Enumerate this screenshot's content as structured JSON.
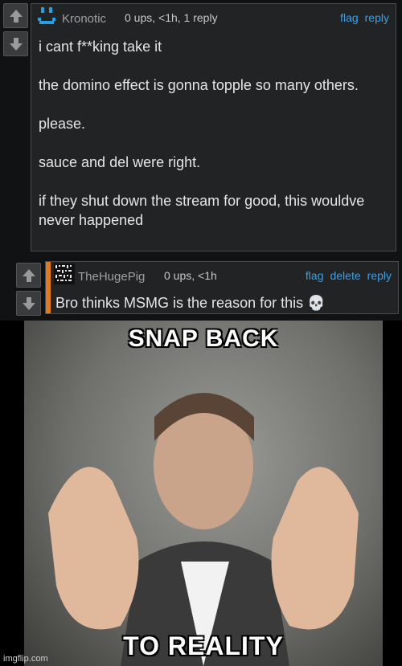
{
  "comments": [
    {
      "username": "Kronotic",
      "meta": "0 ups, <1h, 1 reply",
      "actions": [
        "flag",
        "reply"
      ],
      "paragraphs": [
        "i cant f**king take it",
        "the domino effect is gonna topple so many others.",
        "please.",
        "sauce and del were right.",
        "if they shut down the stream for good, this wouldve never happened"
      ]
    },
    {
      "username": "TheHugePig",
      "meta": "0 ups, <1h",
      "actions": [
        "flag",
        "delete",
        "reply"
      ],
      "text": "Bro thinks MSMG is the reason for this 💀"
    }
  ],
  "meme": {
    "top_text": "SNAP BACK",
    "bottom_text": "TO REALITY"
  },
  "watermark": "imgflip.com",
  "colors": {
    "background": "#111214",
    "comment_bg": "#222325",
    "link": "#3aa0e6",
    "accent_reply": "#e07a1b",
    "avatar_blue": "#1ea3e8"
  },
  "icons": [
    "upvote-arrow-icon",
    "downvote-arrow-icon",
    "smiley-avatar-icon",
    "pixel-avatar-icon",
    "skull-emoji-icon"
  ]
}
